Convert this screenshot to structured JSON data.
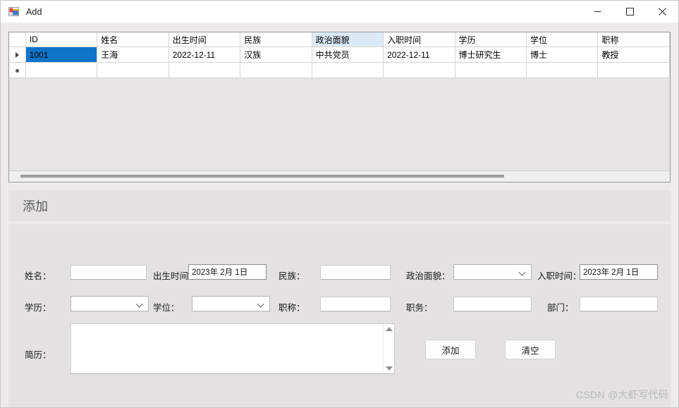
{
  "window": {
    "title": "Add",
    "icon": "winforms-app-icon",
    "controls": {
      "minimize": "–",
      "maximize": "□",
      "close": "✕"
    }
  },
  "grid": {
    "columns": [
      "ID",
      "姓名",
      "出生时间",
      "民族",
      "政治面貌",
      "入职时间",
      "学历",
      "学位",
      "职称"
    ],
    "highlighted_column": "政治面貌",
    "rows": [
      {
        "marker": "current-row-arrow",
        "cells": [
          "1001",
          "王海",
          "2022-12-11",
          "汉族",
          "中共党员",
          "2022-12-11",
          "博士研究生",
          "博士",
          "教授"
        ],
        "selected_cell_index": 0
      },
      {
        "marker": "new-row-asterisk",
        "cells": [
          "",
          "",
          "",
          "",
          "",
          "",
          "",
          "",
          ""
        ],
        "selected_cell_index": -1
      }
    ],
    "selection_color": "#0f74c8",
    "header_highlight_color": "#dceaf7"
  },
  "section": {
    "title": "添加"
  },
  "form": {
    "row1": {
      "name_label": "姓名：",
      "name_value": "",
      "birth_label": "出生时间：",
      "birth_value": "2023年 2月 1日",
      "nation_label": "民族：",
      "nation_value": "",
      "political_label": "政治面貌：",
      "political_value": "",
      "hire_label": "入职时间：",
      "hire_value": "2023年 2月 1日"
    },
    "row2": {
      "education_label": "学历：",
      "education_value": "",
      "degree_label": "学位：",
      "degree_value": "",
      "title_label": "职称：",
      "title_value": "",
      "post_label": "职务：",
      "post_value": "",
      "dept_label": "部门：",
      "dept_value": ""
    },
    "resume": {
      "label": "简历：",
      "value": "",
      "scrollbar": "vertical-scrollbar"
    },
    "buttons": {
      "add": "添加",
      "clear": "清空"
    }
  },
  "watermark": "CSDN @大虾写代码"
}
